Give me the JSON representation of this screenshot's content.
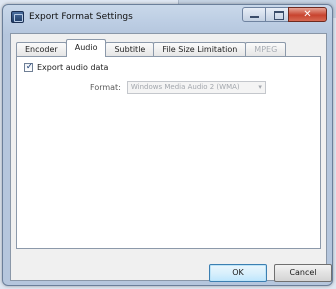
{
  "window": {
    "title": "Export Format Settings",
    "controls": {
      "minimize": "–",
      "maximize": "□",
      "close": "✕"
    }
  },
  "tabs": [
    {
      "label": "Encoder",
      "active": false,
      "enabled": true
    },
    {
      "label": "Audio",
      "active": true,
      "enabled": true
    },
    {
      "label": "Subtitle",
      "active": false,
      "enabled": true
    },
    {
      "label": "File Size Limitation",
      "active": false,
      "enabled": true
    },
    {
      "label": "MPEG",
      "active": false,
      "enabled": false
    }
  ],
  "audio": {
    "export_audio_label": "Export audio data",
    "export_audio_checked": true,
    "checkmark": "✓",
    "format_label": "Format:",
    "format_value": "Windows Media Audio 2 (WMA)",
    "format_arrow": "▾",
    "format_enabled": false
  },
  "buttons": {
    "ok": "OK",
    "cancel": "Cancel"
  }
}
